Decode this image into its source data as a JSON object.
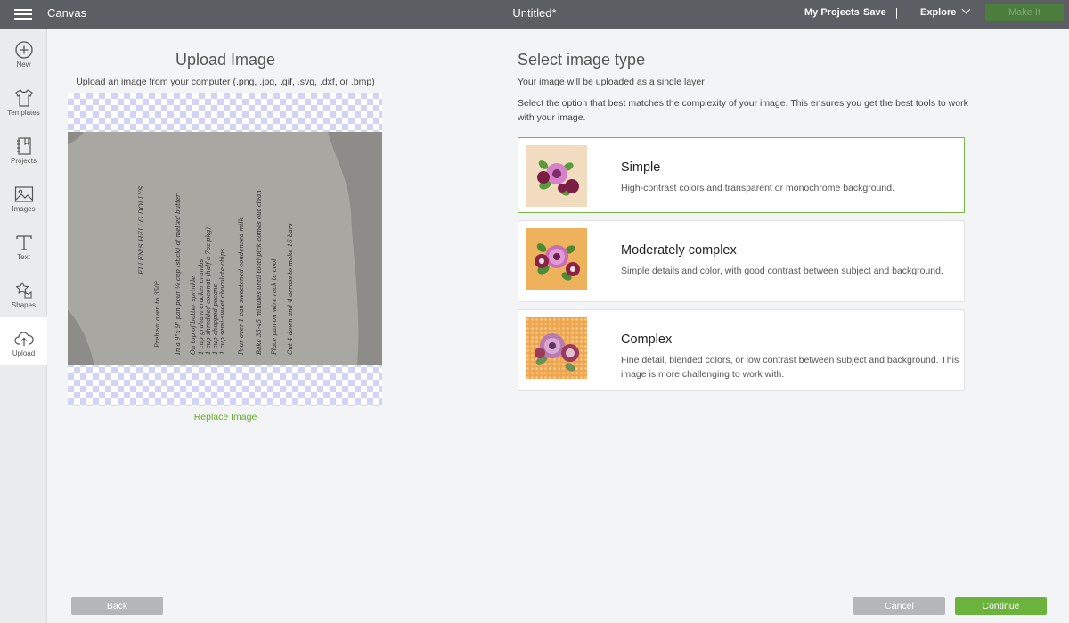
{
  "topbar": {
    "app_title": "Canvas",
    "doc_title": "Untitled*",
    "my_projects": "My Projects",
    "save": "Save",
    "explore": "Explore",
    "make_it": "Make It"
  },
  "sidebar": {
    "items": [
      {
        "label": "New",
        "icon": "plus-circle-icon"
      },
      {
        "label": "Templates",
        "icon": "tshirt-icon"
      },
      {
        "label": "Projects",
        "icon": "notebook-icon"
      },
      {
        "label": "Images",
        "icon": "image-icon"
      },
      {
        "label": "Text",
        "icon": "text-icon"
      },
      {
        "label": "Shapes",
        "icon": "shapes-icon"
      },
      {
        "label": "Upload",
        "icon": "cloud-upload-icon"
      }
    ],
    "active": "Upload"
  },
  "upload": {
    "title": "Upload Image",
    "subtitle": "Upload an image from your computer (.png, .jpg, .gif, .svg, .dxf, or .bmp)",
    "replace": "Replace Image",
    "recipe_lines": [
      "ELLEN'S HELLO DOLLYS",
      "Preheat oven to 350°",
      "In a 9\"x 9\" pan pour ¼ cup (stick) of melted butter",
      "On top of butter sprinkle",
      "1 cup graham cracker crumbs",
      "1 cup shredded coconut (half a 7oz pkg)",
      "1 cup chopped pecans",
      "1 cup semi-sweet chocolate chips",
      "Pour over 1 can sweetened condensed milk",
      "Bake 35-45 minutes until toothpick comes out clean",
      "Place pan on wire rack to cool",
      "Cut 4 down and 4 across to make 16 bars"
    ]
  },
  "select": {
    "title": "Select image type",
    "subtitle": "Your image will be uploaded as a single layer",
    "instructions": "Select the option that best matches the complexity of your image. This ensures you get the best tools to work with your image.",
    "types": [
      {
        "title": "Simple",
        "desc": "High-contrast colors and transparent or monochrome background.",
        "selected": true
      },
      {
        "title": "Moderately complex",
        "desc": "Simple details and color, with good contrast between subject and background."
      },
      {
        "title": "Complex",
        "desc": "Fine detail, blended colors, or low contrast between subject and background. This image is more challenging to work with."
      }
    ]
  },
  "footer": {
    "back": "Back",
    "cancel": "Cancel",
    "continue": "Continue"
  },
  "colors": {
    "topbar": "#5b5f63",
    "accent_green": "#6cb33e",
    "selected_border": "#7ab847",
    "checker": "#d1d4f5"
  }
}
